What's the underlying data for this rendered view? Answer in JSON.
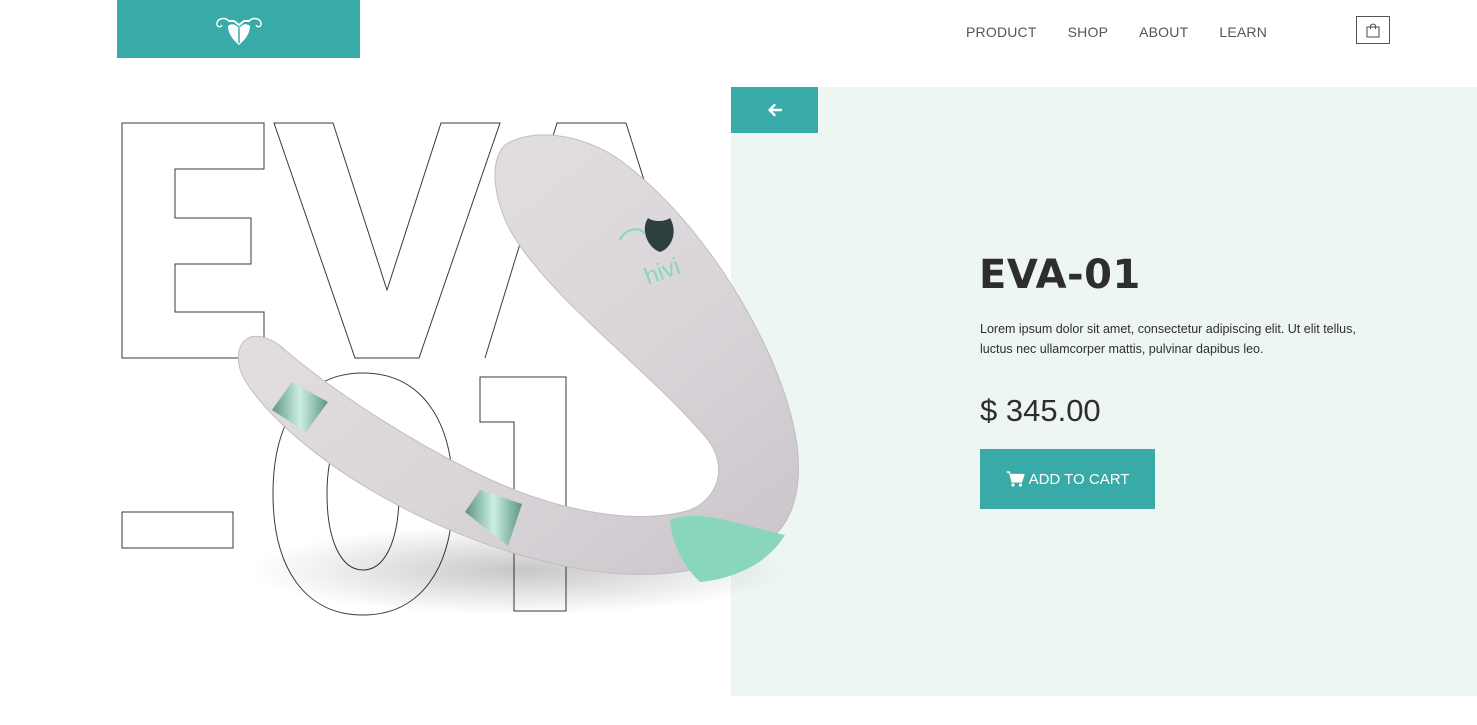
{
  "header": {
    "logo_icon": "leaf-vine-logo-icon",
    "nav": [
      "PRODUCT",
      "SHOP",
      "ABOUT",
      "LEARN"
    ],
    "cart_icon": "shopping-bag-icon"
  },
  "hero": {
    "outline_text_line1": "EVA",
    "outline_text_line2": "-01",
    "product_brand_print": "hivi"
  },
  "product": {
    "back_icon": "arrow-left-icon",
    "name": "EVA-01",
    "description": "Lorem ipsum dolor sit amet, consectetur adipiscing elit. Ut elit tellus, luctus nec ullamcorper mattis, pulvinar dapibus leo.",
    "price": "$ 345.00",
    "add_to_cart_label": "ADD TO CART",
    "add_to_cart_icon": "shopping-cart-icon"
  },
  "colors": {
    "accent": "#38aba8",
    "panel_bg": "#eef6f2",
    "text_dark": "#2e2e2e",
    "mint": "#8ad6bc",
    "product_body": "#dcd8dc"
  }
}
